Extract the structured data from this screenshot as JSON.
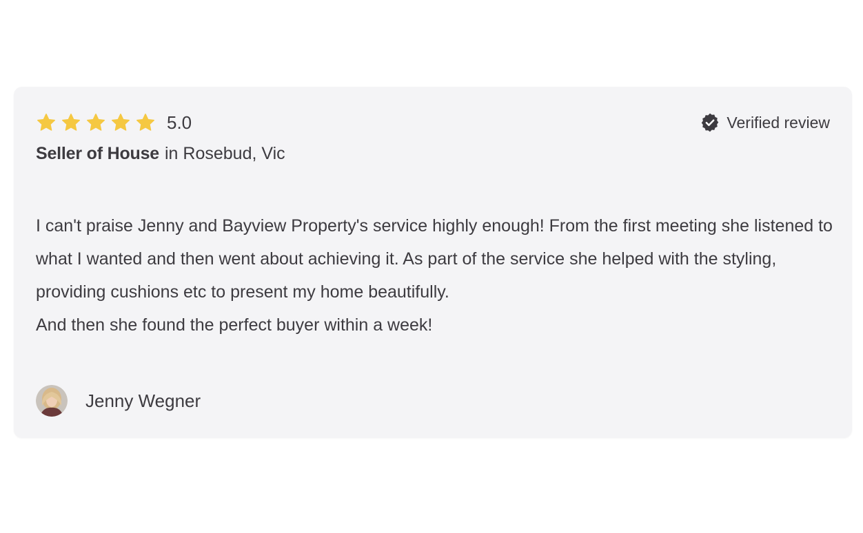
{
  "review": {
    "rating": 5,
    "rating_max": 5,
    "rating_label": "5.0",
    "verified_label": "Verified review",
    "role": "Seller of House",
    "location": "in Rosebud, Vic",
    "paragraph_1": "I can't praise Jenny and Bayview Property's service highly enough! From the first meeting she listened to what I wanted and then went about achieving it. As part of the service she helped with the styling, providing cushions etc to present my home beautifully.",
    "paragraph_2": "And then she found the perfect buyer within a week!",
    "author_name": "Jenny Wegner",
    "icons": {
      "star": "star-icon",
      "verified": "verified-badge-icon",
      "avatar": "avatar"
    },
    "colors": {
      "star": "#f5c842",
      "text": "#3d3b40",
      "badge": "#3d3b40",
      "card_background": "#f4f4f6"
    }
  }
}
